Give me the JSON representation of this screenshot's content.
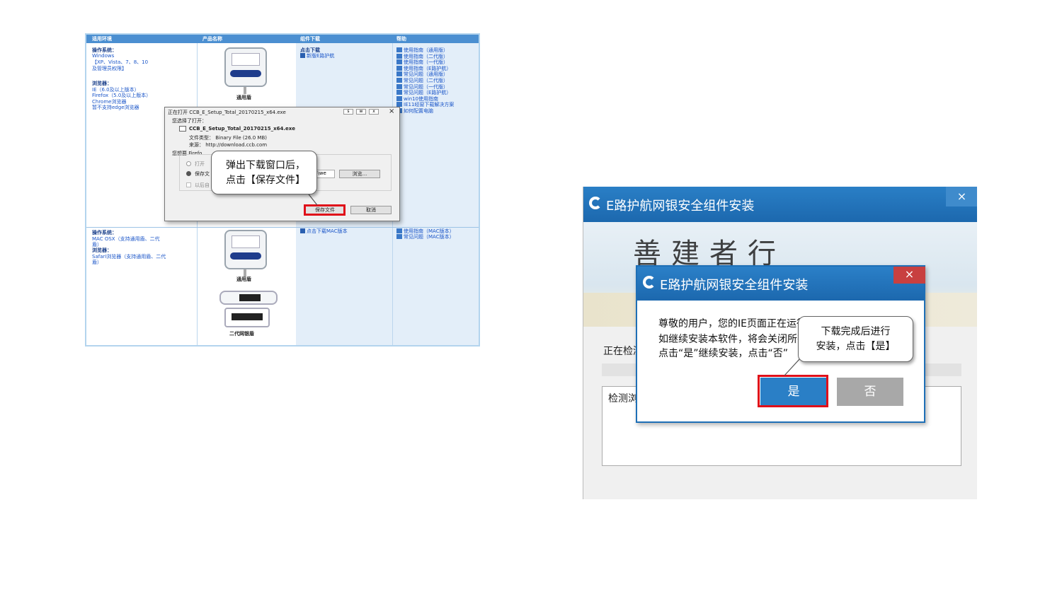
{
  "left_page": {
    "headers": [
      "适用环境",
      "产品名称",
      "组件下载",
      "帮助"
    ],
    "env_windows": {
      "os_label": "操作系统：",
      "os_lines": [
        "Windows",
        "【XP、Vista、7、8、10",
        "及管理员权限】"
      ],
      "browser_label": "浏览器：",
      "browser_lines": [
        "IE（6.0及以上版本）",
        "Firefox（5.0及以上版本）",
        "Chrome浏览器",
        "暂不支持edge浏览器"
      ]
    },
    "product_general": "通用盾",
    "download": {
      "title": "点击下载",
      "link": "新版E路护航",
      "mac_link": "点击下载MAC版本"
    },
    "help_links": [
      "使用指南（通用版）",
      "使用指南（二代版）",
      "使用指南（一代版）",
      "使用指南（E路护航）",
      "常见问题（通用版）",
      "常见问题（二代版）",
      "常见问题（一代版）",
      "常见问题（E路护航）",
      "win10使用指南",
      "IE11经窗下载解决方案",
      "如何配置电脑"
    ],
    "env_mac": {
      "os_label": "操作系统：",
      "os_lines": [
        "MAC OSX（支持通用盾、二代",
        "盾）"
      ],
      "browser_label": "浏览器：",
      "browser_lines": [
        "Safari浏览器（支持通用盾、二代",
        "盾）"
      ]
    },
    "product_general_2": "通用盾",
    "product_second_gen": "二代网银盾",
    "mac_help_links": [
      "使用指南（MAC版本）",
      "常见问题（MAC版本）"
    ]
  },
  "download_dialog": {
    "title": "正在打开 CCB_E_Setup_Total_20170215_x64.exe",
    "window_buttons": [
      "s",
      "w",
      "x"
    ],
    "close": "×",
    "chosen_label": "您选择了打开：",
    "filename": "CCB_E_Setup_Total_20170215_x64.exe",
    "file_type": "文件类型：  Binary File (26.0 MB)",
    "source": "来源：  http://download.ccb.com",
    "question": "您想要 Firefo",
    "option_open": "打开",
    "option_save": "保存文",
    "option_auto": "以后自",
    "path_value": "p\\we",
    "browse": "浏览...",
    "save_button": "保存文件",
    "cancel_button": "取消"
  },
  "callout_left": {
    "line1": "弹出下载窗口后，",
    "line2": "点击【保存文件】"
  },
  "installer": {
    "title": "E路护航网银安全组件安装",
    "close": "×",
    "banner_text": "善建者行",
    "status_label": "正在检测",
    "log_text": "检测浏"
  },
  "confirm_dialog": {
    "title": "E路护航网银安全组件安装",
    "close": "×",
    "message_lines": [
      "尊敬的用户，您的IE页面正在运行",
      "如继续安装本软件，将会关闭所有",
      "点击“是”继续安装，点击“否”"
    ],
    "yes": "是",
    "no": "否"
  },
  "callout_right": {
    "line1": "下载完成后进行",
    "line2": "安装，点击【是】"
  },
  "colors": {
    "accent_blue": "#1f70b8",
    "highlight_red": "#e0101a",
    "header_blue": "#4b8fd1"
  }
}
